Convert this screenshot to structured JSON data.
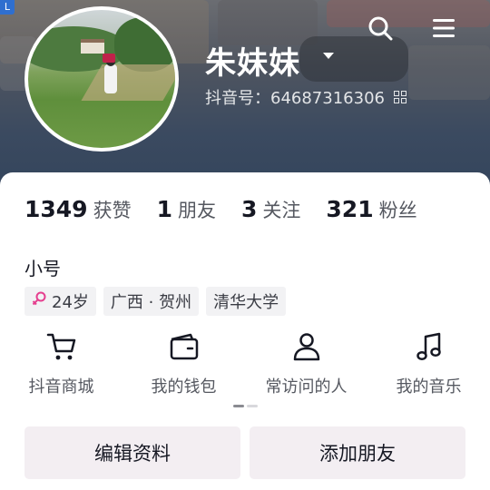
{
  "header": {
    "corner_badge": "L",
    "username": "朱妹妹",
    "douyin_id": "抖音号：64687316306"
  },
  "icons": {
    "search": "search-icon",
    "menu": "menu-icon",
    "caret": "chevron-down-icon",
    "qr": "qr-code-icon"
  },
  "stats": [
    {
      "num": "1349",
      "label": "获赞"
    },
    {
      "num": "1",
      "label": "朋友"
    },
    {
      "num": "3",
      "label": "关注"
    },
    {
      "num": "321",
      "label": "粉丝"
    }
  ],
  "bio": "小号",
  "tags": {
    "age": "24岁",
    "location": "广西 · 贺州",
    "school": "清华大学",
    "gender_color": "#e53f8f"
  },
  "shortcuts": [
    {
      "label": "抖音商城",
      "icon": "cart-icon"
    },
    {
      "label": "我的钱包",
      "icon": "wallet-icon"
    },
    {
      "label": "常访问的人",
      "icon": "person-icon"
    },
    {
      "label": "我的音乐",
      "icon": "music-note-icon"
    }
  ],
  "buttons": {
    "edit_profile": "编辑资料",
    "add_friend": "添加朋友"
  }
}
